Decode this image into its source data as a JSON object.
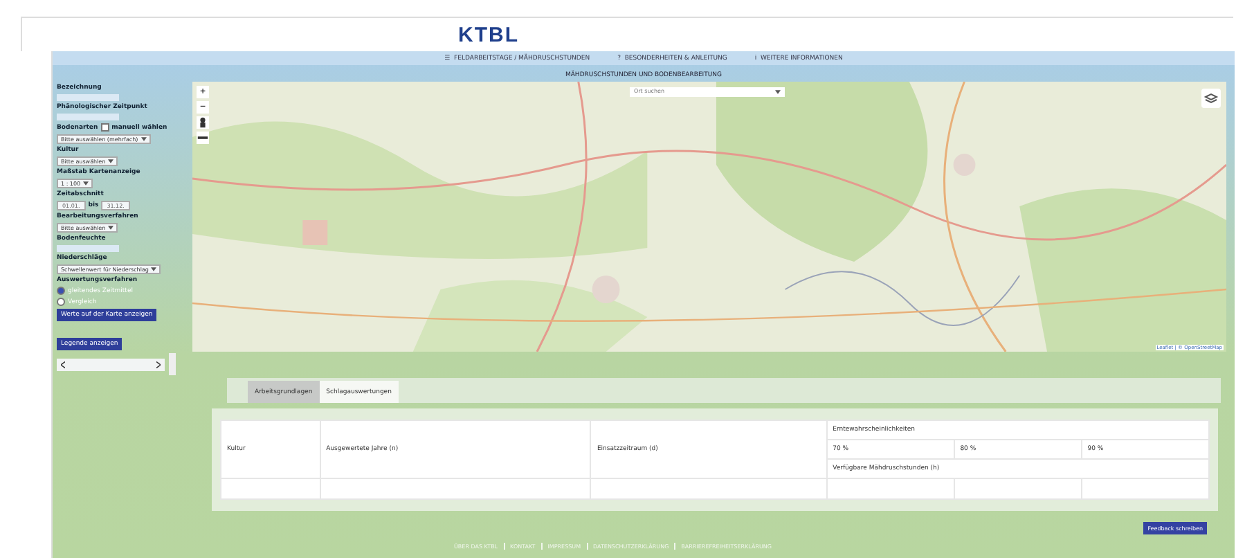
{
  "logo": "KTBL",
  "nav": [
    {
      "icon": "☰",
      "label": "FELDARBEITSTAGE / MÄHDRUSCHSTUNDEN"
    },
    {
      "icon": "?",
      "label": "BESONDERHEITEN & ANLEITUNG"
    },
    {
      "icon": "i",
      "label": "WEITERE INFORMATIONEN"
    }
  ],
  "title": "MÄHDRUSCHSTUNDEN UND BODENBEARBEITUNG",
  "sidebar": [
    {
      "kind": "label",
      "text": "Bezeichnung"
    },
    {
      "kind": "input"
    },
    {
      "kind": "label",
      "text": "Phänologischer Zeitpunkt"
    },
    {
      "kind": "input"
    },
    {
      "kind": "check",
      "text": "Bodenarten",
      "extra": "manuell wählen",
      "checked": false
    },
    {
      "kind": "select",
      "text": "Bitte auswählen (mehrfach)"
    },
    {
      "kind": "label",
      "text": "Kultur"
    },
    {
      "kind": "select",
      "text": "Bitte auswählen"
    },
    {
      "kind": "label",
      "text": "Maßstab Kartenanzeige"
    },
    {
      "kind": "select",
      "text": "1 : 100"
    },
    {
      "kind": "label",
      "text": "Zeitabschnitt"
    },
    {
      "kind": "range",
      "text": "01.01.",
      "extra": "31.12.",
      "mid": "bis"
    },
    {
      "kind": "label",
      "text": "Bearbeitungsverfahren"
    },
    {
      "kind": "select",
      "text": "Bitte auswählen"
    },
    {
      "kind": "label",
      "text": "Bodenfeuchte"
    },
    {
      "kind": "input"
    },
    {
      "kind": "label",
      "text": "Niederschläge"
    },
    {
      "kind": "select",
      "text": "Schwellenwert für Niederschlag"
    },
    {
      "kind": "label",
      "text": "Auswertungsverfahren"
    },
    {
      "kind": "radio",
      "text": "gleitendes Zeitmittel",
      "selected": true
    },
    {
      "kind": "radio",
      "text": "Vergleich",
      "selected": false
    },
    {
      "kind": "button",
      "text": "Werte auf der Karte anzeigen"
    }
  ],
  "legend_button": "Legende anzeigen",
  "map": {
    "search_placeholder": "Ort suchen",
    "zoom_in": "+",
    "zoom_out": "−",
    "attribution": "Leaflet | © OpenStreetMap"
  },
  "tabs": [
    {
      "label": "Arbeitsgrundlagen",
      "selected": true
    },
    {
      "label": "Schlagauswertungen",
      "selected": false
    }
  ],
  "table": {
    "columns": [
      "Kultur",
      "Ausgewertete Jahre (n)",
      "Einsatzzeitraum (d)"
    ],
    "group": "Erntewahrscheinlichkeiten",
    "percent": [
      "70 %",
      "80 %",
      "90 %"
    ],
    "sub": "Verfügbare Mähdruschstunden (h)"
  },
  "feedback_button": "Feedback schreiben",
  "footer": [
    "ÜBER DAS KTBL",
    "KONTAKT",
    "IMPRESSUM",
    "DATENSCHUTZERKLÄRUNG",
    "BARRIEREFREIHEITSERKLÄRUNG"
  ]
}
